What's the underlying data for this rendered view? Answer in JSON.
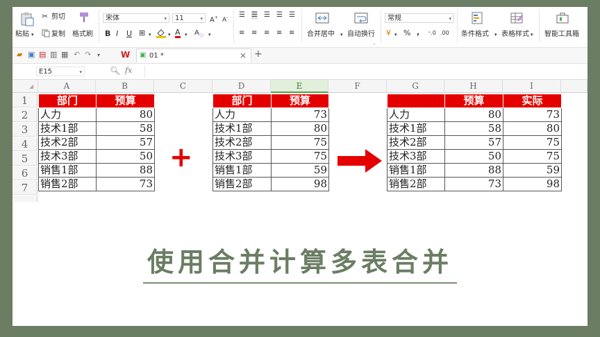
{
  "ribbon": {
    "paste": "粘贴",
    "cut": "剪切",
    "copy": "复制",
    "format_painter": "格式刷",
    "font_name": "宋体",
    "font_size": "11",
    "bold": "B",
    "italic": "I",
    "underline": "U",
    "merge_center": "合并居中",
    "wrap_text": "自动换行",
    "number_format": "常规",
    "percent": "%",
    "comma": ",",
    "conditional_format": "条件格式",
    "table_style": "表格样式",
    "smart_toolbox": "智能工具箱"
  },
  "quick_access": {
    "tab_name": "01 *",
    "close": "×",
    "new_tab": "+"
  },
  "formula_bar": {
    "cell_ref": "E15",
    "fx": "fx",
    "value": ""
  },
  "sheet": {
    "columns": [
      "A",
      "B",
      "C",
      "D",
      "E",
      "F",
      "G",
      "H",
      "I"
    ],
    "rows": [
      "1",
      "2",
      "3",
      "4",
      "5",
      "6",
      "7"
    ],
    "table1": {
      "headers": [
        "部门",
        "预算"
      ],
      "rows": [
        [
          "人力",
          "80"
        ],
        [
          "技术1部",
          "58"
        ],
        [
          "技术2部",
          "57"
        ],
        [
          "技术3部",
          "50"
        ],
        [
          "销售1部",
          "88"
        ],
        [
          "销售2部",
          "73"
        ]
      ]
    },
    "table2": {
      "headers": [
        "部门",
        "预算"
      ],
      "rows": [
        [
          "人力",
          "73"
        ],
        [
          "技术1部",
          "80"
        ],
        [
          "技术2部",
          "75"
        ],
        [
          "技术3部",
          "75"
        ],
        [
          "销售1部",
          "59"
        ],
        [
          "销售2部",
          "98"
        ]
      ]
    },
    "table3": {
      "headers": [
        "",
        "预算",
        "实际"
      ],
      "rows": [
        [
          "人力",
          "80",
          "73"
        ],
        [
          "技术1部",
          "58",
          "80"
        ],
        [
          "技术2部",
          "57",
          "75"
        ],
        [
          "技术3部",
          "50",
          "75"
        ],
        [
          "销售1部",
          "88",
          "59"
        ],
        [
          "销售2部",
          "73",
          "98"
        ]
      ]
    },
    "plus_symbol": "+"
  },
  "title": "使用合并计算多表合并",
  "colors": {
    "header_red": "#e50000",
    "frame_green": "#6b7d63",
    "selected_col": "#e2efda"
  }
}
